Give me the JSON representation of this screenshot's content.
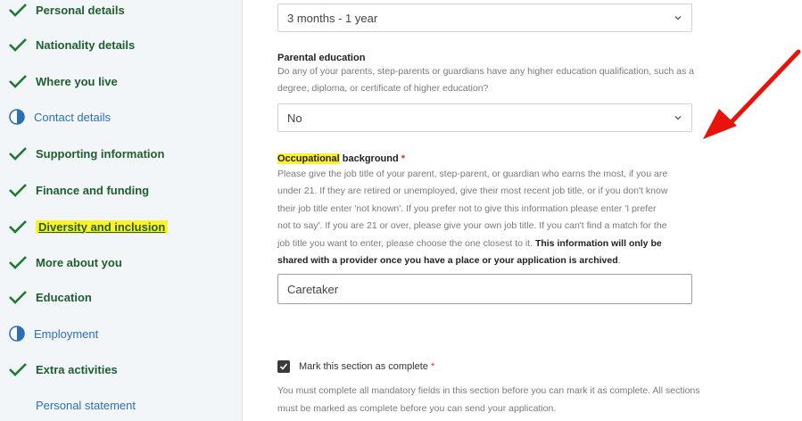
{
  "sidebar": {
    "items": [
      {
        "label": "Personal details",
        "status": "complete"
      },
      {
        "label": "Nationality details",
        "status": "complete"
      },
      {
        "label": "Where you live",
        "status": "complete"
      },
      {
        "label": "Contact details",
        "status": "in-progress"
      },
      {
        "label": "Supporting information",
        "status": "complete"
      },
      {
        "label": "Finance and funding",
        "status": "complete"
      },
      {
        "label": "Diversity and inclusion",
        "status": "complete"
      },
      {
        "label": "More about you",
        "status": "complete"
      },
      {
        "label": "Education",
        "status": "complete"
      },
      {
        "label": "Employment",
        "status": "in-progress"
      },
      {
        "label": "Extra activities",
        "status": "complete"
      },
      {
        "label": "Personal statement",
        "status": "not-started"
      }
    ]
  },
  "main": {
    "duration_select": {
      "value": "3 months - 1 year"
    },
    "parental_education": {
      "label": "Parental education",
      "hint": "Do any of your parents, step-parents or guardians have any higher education qualification, such as a degree, diploma, or certificate of higher education?",
      "value": "No"
    },
    "occupational": {
      "label_highlight": "Occupational",
      "label_rest": " background",
      "required_mark": "*",
      "hint_line1": "Please give the job title of your parent, step-parent, or guardian who earns the most, if you are",
      "hint_line2": "under 21. If they are retired or unemployed, give their most recent job title, or if you don't know",
      "hint_line3": "their job title enter 'not known'. If you prefer not to give this information please enter 'I prefer",
      "hint_line4": "not to say'. If you are 21 or over, please give your own job title. If you can't find a match for the",
      "hint_line5_plain": "job title you want to enter, please choose the one closest to it. ",
      "hint_line5_bold": "This information will only be",
      "hint_line6_bold": "shared with a provider once you have a place or your application is archived",
      "hint_line6_end": ".",
      "value": "Caretaker"
    },
    "complete": {
      "label": "Mark this section as complete",
      "required_mark": "*",
      "checked": true,
      "note": "You must complete all mandatory fields in this section before you can mark it as complete. All sections must be marked as complete before you can send your application."
    }
  },
  "colors": {
    "check_green": "#1f7a34",
    "highlight": "#fff22a",
    "arrow": "#e8140c",
    "link_blue": "#2d6fb7"
  }
}
